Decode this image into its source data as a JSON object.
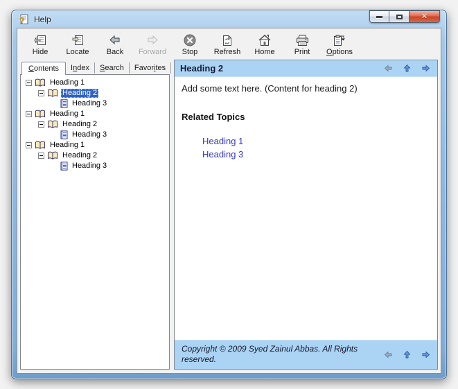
{
  "window": {
    "title": "Help"
  },
  "toolbar": {
    "hide": "Hide",
    "locate": "Locate",
    "back": "Back",
    "forward": "Forward",
    "stop": "Stop",
    "refresh": "Refresh",
    "home": "Home",
    "print": "Print",
    "options": {
      "pre": "",
      "accel": "O",
      "post": "ptions"
    }
  },
  "tabs": [
    {
      "pre": "",
      "accel": "C",
      "post": "ontents"
    },
    {
      "pre": "I",
      "accel": "n",
      "post": "dex"
    },
    {
      "pre": "",
      "accel": "S",
      "post": "earch"
    },
    {
      "pre": "Favor",
      "accel": "i",
      "post": "tes"
    }
  ],
  "tree": {
    "rows": [
      {
        "label": "Heading 1",
        "level": 1,
        "icon": "book"
      },
      {
        "label": "Heading 2",
        "level": 2,
        "icon": "book",
        "selected": true
      },
      {
        "label": "Heading 3",
        "level": 3,
        "icon": "page"
      },
      {
        "label": "Heading 1",
        "level": 1,
        "icon": "book"
      },
      {
        "label": "Heading 2",
        "level": 2,
        "icon": "book"
      },
      {
        "label": "Heading 3",
        "level": 3,
        "icon": "page"
      },
      {
        "label": "Heading 1",
        "level": 1,
        "icon": "book"
      },
      {
        "label": "Heading 2",
        "level": 2,
        "icon": "book"
      },
      {
        "label": "Heading 3",
        "level": 3,
        "icon": "page"
      }
    ]
  },
  "content": {
    "header": {
      "title": "Heading 2"
    },
    "body": {
      "paragraph": "Add some text here. (Content for heading 2)",
      "related_topics_heading": "Related Topics",
      "links": [
        "Heading 1",
        "Heading 3"
      ]
    },
    "footer": {
      "copyright": "Copyright © 2009 Syed Zainul Abbas. All Rights reserved."
    }
  },
  "colors": {
    "pane_header_blue": "#abd4f4",
    "selection_blue": "#2e62c6",
    "link_blue": "#3636c8",
    "frame_blue": "#8db8e2",
    "close_red": "#c94628"
  }
}
